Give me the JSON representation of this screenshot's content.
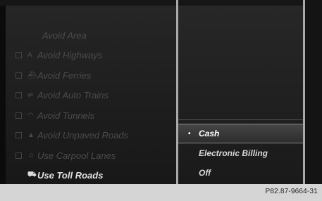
{
  "route_options": {
    "header": "Avoid Area",
    "items": [
      {
        "label": "Avoid Highways",
        "icon": "A",
        "icon_name": "highway-icon",
        "active": false
      },
      {
        "label": "Avoid Ferries",
        "icon": "⛴",
        "icon_name": "ferry-icon",
        "active": false
      },
      {
        "label": "Avoid Auto Trains",
        "icon": "⇌",
        "icon_name": "auto-train-icon",
        "active": false
      },
      {
        "label": "Avoid Tunnels",
        "icon": "◠",
        "icon_name": "tunnel-icon",
        "active": false
      },
      {
        "label": "Avoid Unpaved Roads",
        "icon": "▲",
        "icon_name": "unpaved-road-icon",
        "active": false
      },
      {
        "label": "Use Carpool Lanes",
        "icon": "☺",
        "icon_name": "carpool-icon",
        "active": false
      },
      {
        "label": "Use Toll Roads",
        "icon": "⛟",
        "icon_name": "toll-road-icon",
        "active": true
      }
    ]
  },
  "toll_submenu": {
    "options": [
      {
        "label": "Cash",
        "selected": true
      },
      {
        "label": "Electronic Billing",
        "selected": false
      },
      {
        "label": "Off",
        "selected": false
      }
    ],
    "selected_marker": "•"
  },
  "caption": "P82.87-9664-31"
}
